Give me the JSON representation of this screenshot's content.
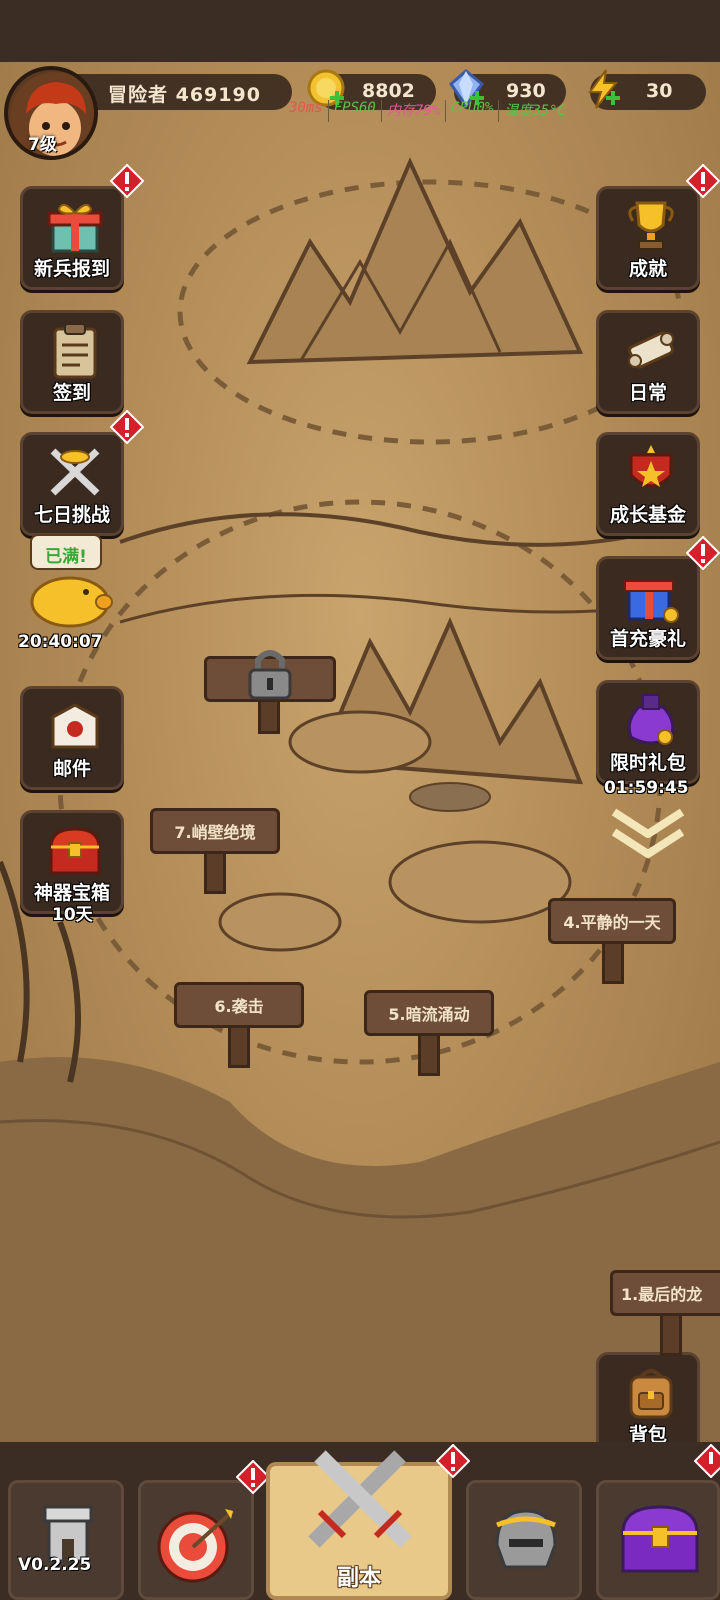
{
  "player": {
    "name": "冒险者 469190",
    "level": "7级"
  },
  "resources": {
    "gold": "8802",
    "gems": "930",
    "energy": "30"
  },
  "perf": {
    "ping": "30ms",
    "fps": "FPS60",
    "memory": "内存79%",
    "cpu": "CPU0%",
    "temperature": "温度35°C"
  },
  "left_menu": {
    "recruit": "新兵报到",
    "signin": "签到",
    "seven_day": "七日挑战",
    "piggy_bubble": "已满!",
    "piggy_timer": "20:40:07",
    "mail": "邮件",
    "artifact_chest": "神器宝箱",
    "artifact_days": "10天"
  },
  "right_menu": {
    "achievement": "成就",
    "daily": "日常",
    "growth_fund": "成长基金",
    "first_recharge": "首充豪礼",
    "limited_pack": "限时礼包",
    "limited_timer": "01:59:45",
    "backpack": "背包"
  },
  "stages": {
    "s7": "7.峭壁绝境",
    "s6": "6.袭击",
    "s5": "5.暗流涌动",
    "s4": "4.平静的一天",
    "s1": "1.最后的龙"
  },
  "bottom_nav": {
    "dungeon": "副本",
    "version": "V0.2.25"
  },
  "colors": {
    "alert": "#d4202a",
    "map": "#b48d58",
    "panel": "#3a2a20",
    "accent_gold": "#e8c98a"
  }
}
